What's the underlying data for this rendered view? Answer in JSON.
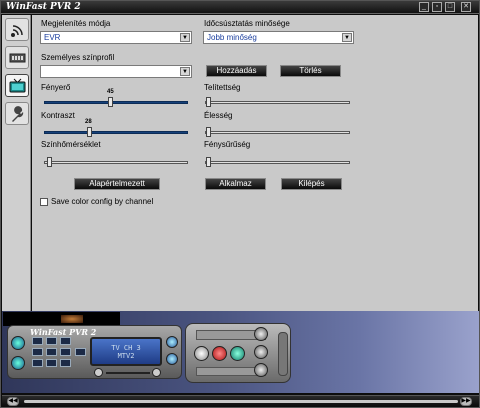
{
  "window": {
    "title": "WinFast PVR 2",
    "controls": [
      "minimize-icon",
      "restore-icon",
      "maximize-icon",
      "close-icon"
    ]
  },
  "sidebar": {
    "tabs": [
      {
        "name": "signal-tab",
        "icon": "antenna-icon",
        "active": false
      },
      {
        "name": "device-tab",
        "icon": "tuner-card-icon",
        "active": false
      },
      {
        "name": "tv-tab",
        "icon": "tv-icon",
        "active": true
      },
      {
        "name": "tools-tab",
        "icon": "wrench-icon",
        "active": false
      }
    ]
  },
  "color": {
    "display_mode_label": "Megjelenítés módja",
    "display_mode_value": "EVR",
    "timeshift_label": "Időcsúsztatás minősége",
    "timeshift_value": "Jobb minőség",
    "profile_label": "Személyes színprofil",
    "profile_value": "",
    "add_button": "Hozzáadás",
    "delete_button": "Törlés",
    "brightness_label": "Fényerő",
    "brightness_value": "45",
    "saturation_label": "Telítettség",
    "contrast_label": "Kontraszt",
    "contrast_value": "28",
    "sharpness_label": "Élesség",
    "color_temp_label": "Színhőmérséklet",
    "luminance_label": "Fénysűrűség",
    "default_button": "Alapértelmezett",
    "apply_button": "Alkalmaz",
    "exit_button": "Kilépés",
    "save_channel_label": "Save color config by channel",
    "save_channel_checked": false
  },
  "remote": {
    "title": "WinFast PVR 2",
    "lcd_line1": "TV CH 3",
    "lcd_line2": "MTV2"
  },
  "colors": {
    "panel": "#c9c9c9",
    "slider_active": "#15407a",
    "select_text": "#1a3e9e"
  }
}
